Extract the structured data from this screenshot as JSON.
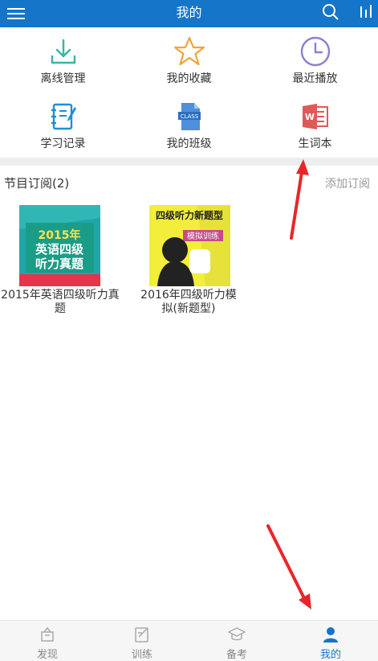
{
  "header": {
    "title": "我的"
  },
  "menu": [
    {
      "label": "离线管理",
      "icon": "download-icon",
      "color": "#3bb5a6"
    },
    {
      "label": "我的收藏",
      "icon": "star-icon",
      "color": "#f5a23a"
    },
    {
      "label": "最近播放",
      "icon": "clock-icon",
      "color": "#8a7fd6"
    },
    {
      "label": "学习记录",
      "icon": "notebook-icon",
      "color": "#1e8fd6"
    },
    {
      "label": "我的班级",
      "icon": "class-file-icon",
      "color": "#4f8fdc"
    },
    {
      "label": "生词本",
      "icon": "word-book-icon",
      "color": "#e05959"
    }
  ],
  "subscriptions": {
    "title": "节目订阅(2)",
    "add_label": "添加订阅",
    "items": [
      {
        "caption_line1": "2015年英语四级听力真",
        "caption_line2": "题",
        "cover_year": "2015年",
        "cover_line1": "英语四级",
        "cover_line2": "听力真题"
      },
      {
        "caption_line1": "2016年四级听力模",
        "caption_line2": "拟(新题型)",
        "cover_title": "四级听力新题型",
        "cover_badge": "模拟训练"
      }
    ]
  },
  "tabbar": {
    "tabs": [
      {
        "label": "发现",
        "icon": "discover-icon"
      },
      {
        "label": "训练",
        "icon": "train-icon"
      },
      {
        "label": "备考",
        "icon": "graduation-cap-icon"
      },
      {
        "label": "我的",
        "icon": "person-icon",
        "active": true
      }
    ]
  },
  "colors": {
    "primary": "#1576c9",
    "annotation_arrow": "#e8262a"
  }
}
